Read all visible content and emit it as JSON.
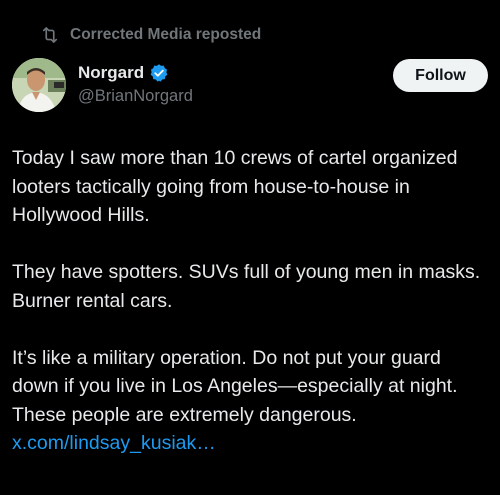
{
  "repost": {
    "icon": "repost-icon",
    "label": "Corrected Media reposted"
  },
  "author": {
    "display_name": "Norgard",
    "handle": "@BrianNorgard",
    "verified_icon": "verified-badge-icon",
    "avatar": "avatar-photo",
    "follow_label": "Follow"
  },
  "tweet": {
    "paragraphs": [
      "Today I saw more than 10 crews of cartel organized looters tactically going from house-to-house in Hollywood Hills.",
      "They have spotters. SUVs full of young men in masks. Burner rental cars.",
      "It’s like a military operation. Do not put your guard down if you live in Los Angeles—especially at night. These people are extremely dangerous."
    ],
    "link_text": "x.com/lindsay_kusiak…"
  },
  "colors": {
    "background": "#000000",
    "text": "#e7e9ea",
    "muted": "#71767b",
    "link": "#1d9bf0",
    "verified": "#1d9bf0",
    "follow_bg": "#eff3f4"
  }
}
